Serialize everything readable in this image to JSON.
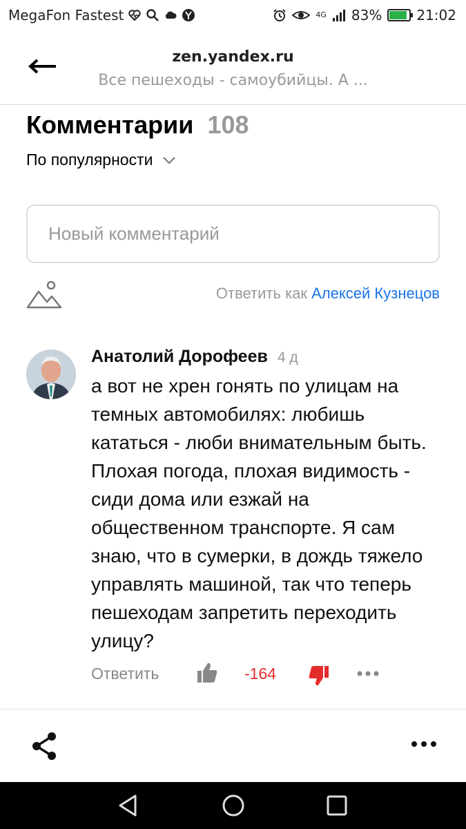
{
  "status_bar": {
    "carrier": "MegaFon Fastest",
    "network": "4G",
    "battery": "83%",
    "battery_level": 0.83,
    "time": "21:02"
  },
  "header": {
    "domain": "zen.yandex.ru",
    "subtitle": "Все пешеходы - самоубийцы. А ..."
  },
  "comments": {
    "title": "Комментарии",
    "count": "108",
    "sort_label": "По популярности",
    "new_comment_placeholder": "Новый комментарий",
    "reply_as_prefix": "Ответить как",
    "reply_as_name": "Алексей Кузнецов"
  },
  "comment": {
    "author": "Анатолий Дорофеев",
    "age": "4 д",
    "text": "а вот не хрен гонять по улицам на темных автомобилях: любишь кататься - люби внимательным быть. Плохая погода, плохая видимость - сиди дома или езжай на общественном транспорте. Я сам знаю, что в сумерки, в дождь тяжело управлять машиной, так что теперь пешеходам запретить переходить улицу?",
    "reply_label": "Ответить",
    "score": "-164"
  },
  "colors": {
    "link": "#1a73e8",
    "negative": "#e52c2c",
    "muted": "#999999"
  }
}
